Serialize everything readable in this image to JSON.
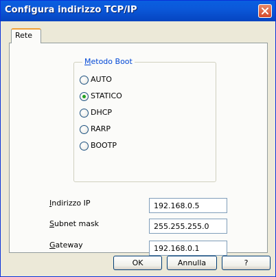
{
  "window": {
    "title": "Configura indirizzo TCP/IP"
  },
  "tabs": [
    {
      "label": "Rete",
      "active": true
    }
  ],
  "boot_method": {
    "legend_prefix": "M",
    "legend_rest": "etodo Boot",
    "options": [
      {
        "label": "AUTO",
        "checked": false
      },
      {
        "label": "STATICO",
        "checked": true
      },
      {
        "label": "DHCP",
        "checked": false
      },
      {
        "label": "RARP",
        "checked": false
      },
      {
        "label": "BOOTP",
        "checked": false
      }
    ]
  },
  "fields": {
    "ip": {
      "label_prefix": "I",
      "label_rest": "ndirizzo IP",
      "value": "192.168.0.5"
    },
    "subnet": {
      "label_prefix": "S",
      "label_rest": "ubnet mask",
      "value": "255.255.255.0"
    },
    "gateway": {
      "label_prefix": "G",
      "label_rest": "ateway",
      "value": "192.168.0.1"
    }
  },
  "buttons": {
    "ok": "OK",
    "cancel": "Annulla",
    "help": "?"
  },
  "colors": {
    "titlebar": "#0b58d9",
    "close_button": "#d4492a",
    "legend_text": "#0046d5",
    "radio_checked": "#21a121",
    "tab_highlight": "#f0a036"
  }
}
